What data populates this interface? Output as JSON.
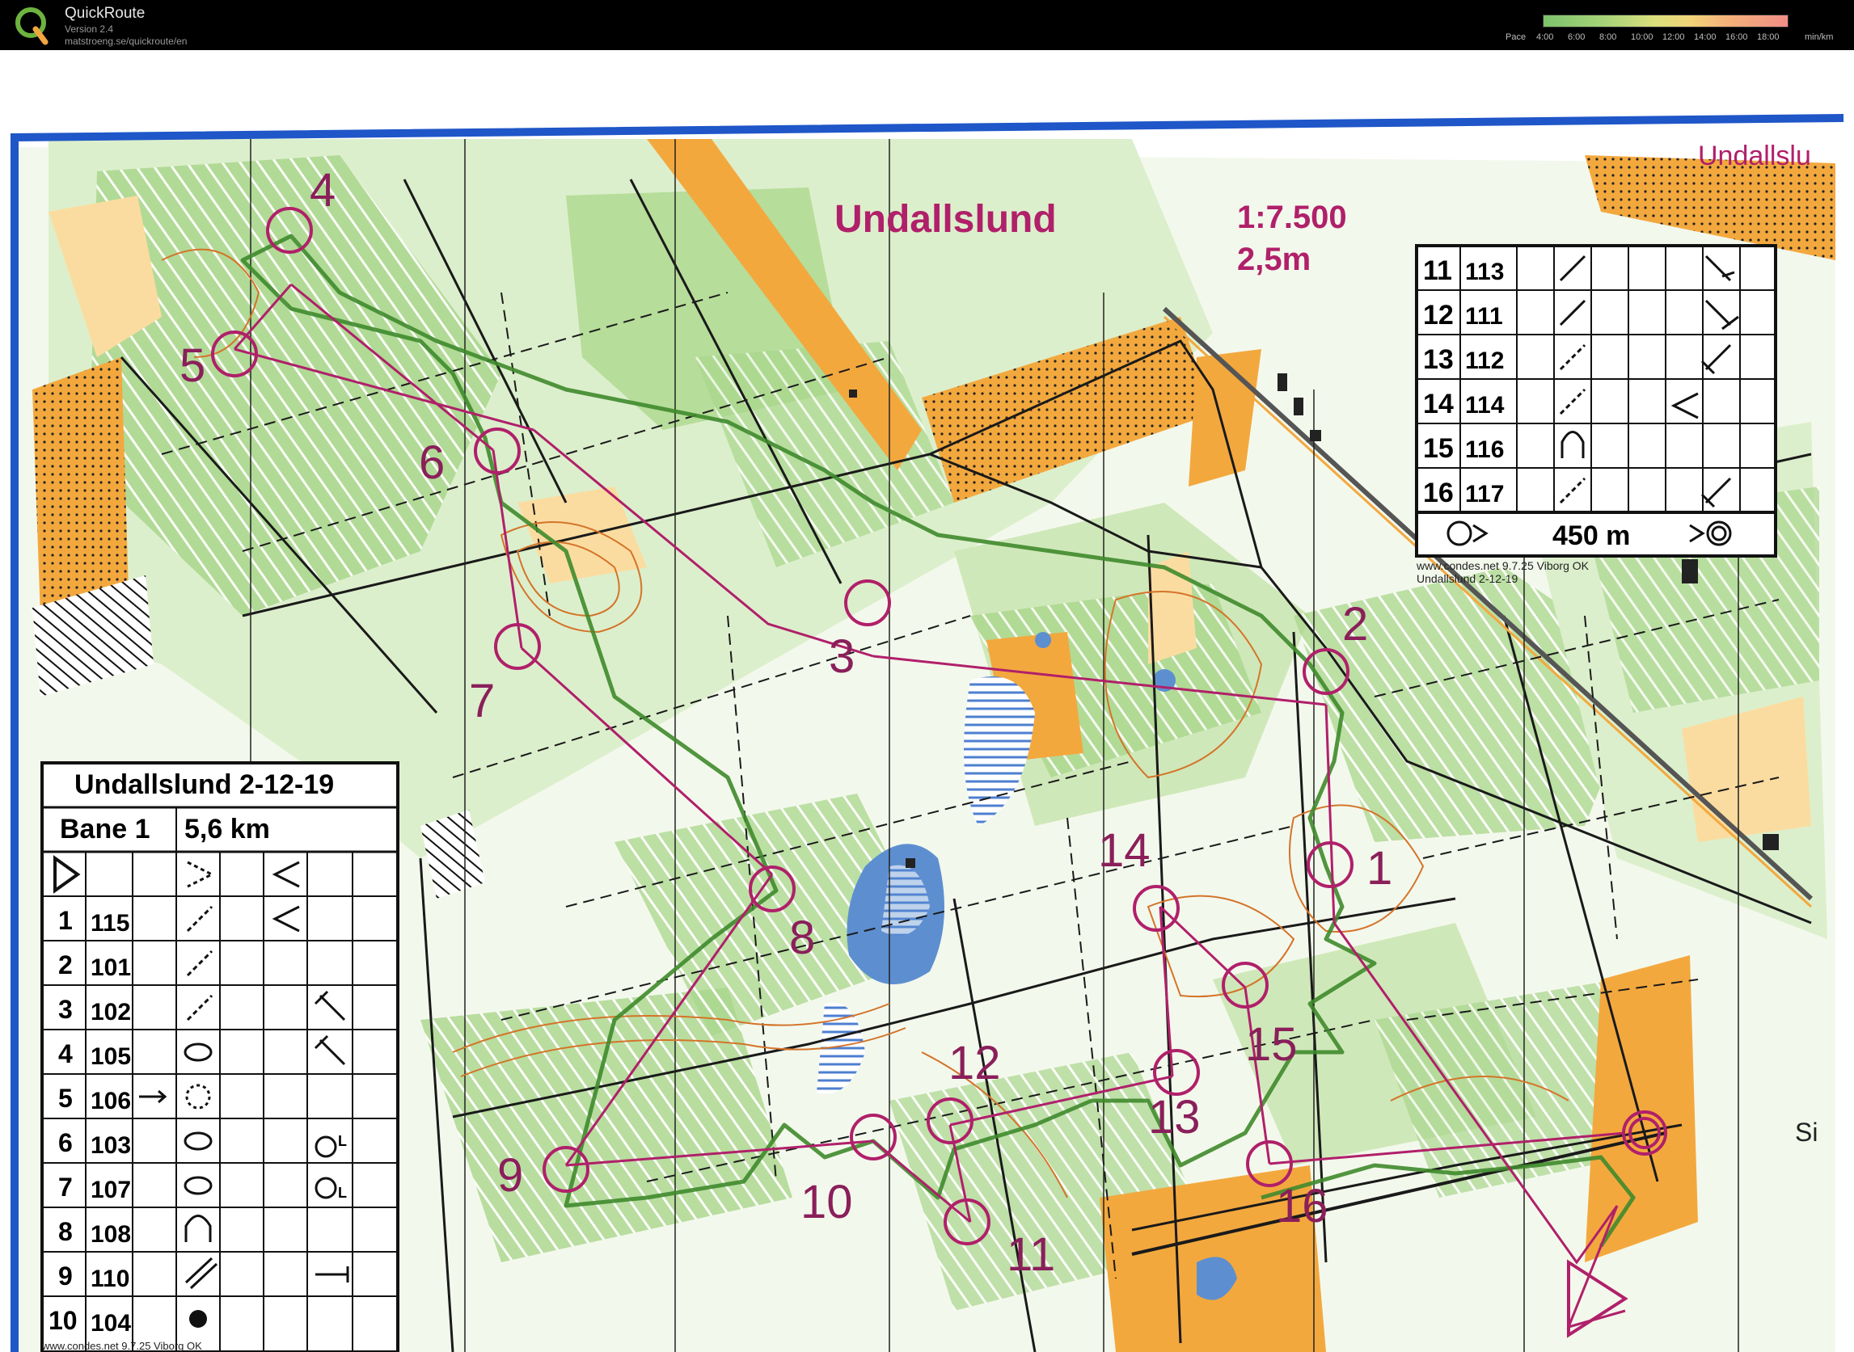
{
  "app": {
    "name": "QuickRoute",
    "version": "Version 2.4",
    "url": "matstroeng.se/quickroute/en",
    "logo_letter": "Q"
  },
  "pace_scale": {
    "label": "Pace",
    "ticks": [
      "4:00",
      "6:00",
      "8:00",
      "10:00",
      "12:00",
      "14:00",
      "16:00",
      "18:00"
    ],
    "unit": "min/km"
  },
  "map": {
    "title": "Undallslund",
    "scale": "1:7.500",
    "contour": "2,5m",
    "corner_text": "Undallslu",
    "edge_text": "Si",
    "credit_top": "www.condes.net 9.7.25 Viborg OK",
    "credit_top_2": "Undallslund 2-12-19",
    "credit_bottom": "www.condes.net 9.7.25 Viborg OK",
    "controls": [
      {
        "n": "1"
      },
      {
        "n": "2"
      },
      {
        "n": "3"
      },
      {
        "n": "4"
      },
      {
        "n": "5"
      },
      {
        "n": "6"
      },
      {
        "n": "7"
      },
      {
        "n": "8"
      },
      {
        "n": "9"
      },
      {
        "n": "10"
      },
      {
        "n": "11"
      },
      {
        "n": "12"
      },
      {
        "n": "13"
      },
      {
        "n": "14"
      },
      {
        "n": "15"
      },
      {
        "n": "16"
      }
    ]
  },
  "description_main": {
    "title": "Undallslund 2-12-19",
    "course": "Bane 1",
    "length": "5,6 km",
    "rows": [
      {
        "n": "1",
        "code": "115"
      },
      {
        "n": "2",
        "code": "101"
      },
      {
        "n": "3",
        "code": "102"
      },
      {
        "n": "4",
        "code": "105"
      },
      {
        "n": "5",
        "code": "106"
      },
      {
        "n": "6",
        "code": "103"
      },
      {
        "n": "7",
        "code": "107"
      },
      {
        "n": "8",
        "code": "108"
      },
      {
        "n": "9",
        "code": "110"
      },
      {
        "n": "10",
        "code": "104"
      }
    ]
  },
  "description_extra": {
    "rows": [
      {
        "n": "11",
        "code": "113"
      },
      {
        "n": "12",
        "code": "111"
      },
      {
        "n": "13",
        "code": "112"
      },
      {
        "n": "14",
        "code": "114"
      },
      {
        "n": "15",
        "code": "116"
      },
      {
        "n": "16",
        "code": "117"
      }
    ],
    "finish_distance": "450 m"
  },
  "colors": {
    "course": "#b0206a",
    "route": "#3f8a2c",
    "forest_green": "#9fcf83",
    "light_green": "#cfe8b9",
    "open_yellow": "#f4b54e",
    "rough_yellow": "#fbdca0",
    "water": "#5d8fd0",
    "frame_blue": "#1f56c8",
    "contour_brown": "#d4742a"
  }
}
